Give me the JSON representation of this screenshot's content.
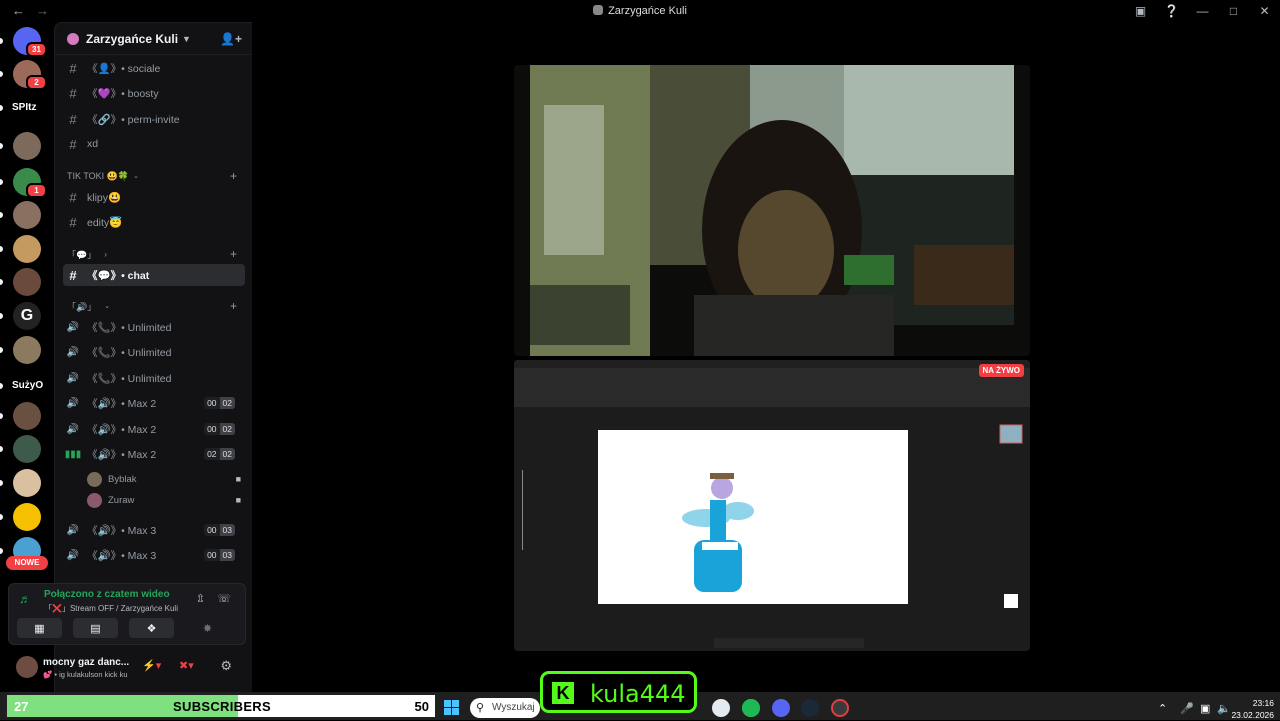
{
  "window": {
    "title": "Zarzygańce Kuli"
  },
  "rail": {
    "servers": [
      {
        "name": "discord-home",
        "badge": "31",
        "color": "#5865f2"
      },
      {
        "name": "server-2",
        "badge": "2",
        "color": "#9b6a5a"
      },
      {
        "name": "server-spitz",
        "badge": "",
        "color": "#1c1c1c"
      },
      {
        "name": "server-4",
        "badge": "",
        "color": "#7d6a5a"
      },
      {
        "name": "server-5",
        "badge": "1",
        "color": "#3a8a4a"
      },
      {
        "name": "server-6",
        "badge": "",
        "color": "#8a7060"
      },
      {
        "name": "server-7",
        "badge": "",
        "color": "#c49a60"
      },
      {
        "name": "server-8",
        "badge": "",
        "color": "#6a4a3a"
      },
      {
        "name": "server-g",
        "badge": "",
        "color": "#222"
      },
      {
        "name": "server-10",
        "badge": "",
        "color": "#8c7a60"
      },
      {
        "name": "server-suzyo",
        "badge": "",
        "color": "#111"
      },
      {
        "name": "server-12",
        "badge": "",
        "color": "#6a5040"
      },
      {
        "name": "server-13",
        "badge": "",
        "color": "#3e5a4a"
      },
      {
        "name": "server-14",
        "badge": "",
        "color": "#d8c0a0"
      },
      {
        "name": "server-15",
        "badge": "",
        "color": "#f4c000"
      },
      {
        "name": "server-16",
        "badge": "",
        "color": "#4aa0d0"
      }
    ],
    "spitz_text": "SPItz",
    "g_text": "G",
    "suzyo_text": "SużyO",
    "nowe_label": "NOWE"
  },
  "server": {
    "name": "Zarzygańce Kuli"
  },
  "channels_top": [
    {
      "name": "《👤》• sociale"
    },
    {
      "name": "《💜》• boosty"
    },
    {
      "name": "《🔗》• perm-invite"
    },
    {
      "name": "xd"
    }
  ],
  "categories": {
    "tiktoki": "TIK TOKI 😃🍀",
    "chat_cat": "「💬」",
    "voice_cat": "「🔊」"
  },
  "channels_tiktok": [
    {
      "name": "klipy😃"
    },
    {
      "name": "edity😇"
    }
  ],
  "channel_active": {
    "name": "《💬》• chat"
  },
  "voice_channels": [
    {
      "name": "《📞》• Unlimited"
    },
    {
      "name": "《📞》• Unlimited"
    },
    {
      "name": "《📞》• Unlimited"
    },
    {
      "name": "《🔊》• Max 2",
      "a": "00",
      "b": "02"
    },
    {
      "name": "《🔊》• Max 2",
      "a": "00",
      "b": "02"
    },
    {
      "name": "《🔊》• Max 2",
      "a": "02",
      "b": "02"
    },
    {
      "name": "《🔊》• Max 3",
      "a": "00",
      "b": "03"
    },
    {
      "name": "《🔊》• Max 3",
      "a": "00",
      "b": "03"
    }
  ],
  "voice_members": [
    {
      "name": "Byblak"
    },
    {
      "name": "Zuraw"
    }
  ],
  "voice_panel": {
    "connected": "Połączono z czatem wideo",
    "status": "「❌」Stream OFF / Zarzygańce Kuli"
  },
  "user_panel": {
    "name": "mocny gaz danc...",
    "status": "💕 • ig kulakulson kick ku"
  },
  "stream": {
    "live_label": "NA ŻYWO"
  },
  "subs_bar": {
    "current": "27",
    "label": "SUBSCRIBERS",
    "goal": "50",
    "progress": 0.54
  },
  "kick": {
    "name": "kula444"
  },
  "taskbar": {
    "search_placeholder": "Wyszukaj",
    "time": "23:16",
    "date": "23.02.2026"
  }
}
